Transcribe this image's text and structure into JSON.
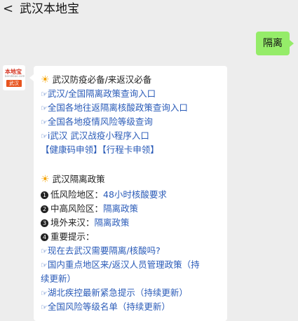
{
  "header": {
    "back_glyph": "<",
    "title": "武汉本地宝"
  },
  "sent_message": "隔离",
  "avatar": {
    "logo": "本地宝",
    "sub": "bendibao.com",
    "tag": "武汉"
  },
  "reply": {
    "section1": {
      "title": "武汉防疫必备/来返汉必备",
      "links": [
        "武汉/全国隔离政策查询入口",
        "全国各地往返隔离核酸政策查询入口",
        "全国各地疫情风险等级查询",
        "i武汉 武汉战疫小程序入口"
      ],
      "extra_links": [
        "【健康码申领】",
        "【行程卡申领】"
      ]
    },
    "section2": {
      "title": "武汉隔离政策",
      "items": [
        {
          "num": "1",
          "label": "低风险地区：",
          "value": "48小时核酸要求"
        },
        {
          "num": "2",
          "label": "中高风险区：",
          "value": "隔离政策"
        },
        {
          "num": "3",
          "label": "境外来汉：",
          "value": "隔离政策"
        },
        {
          "num": "4",
          "label": "重要提示：",
          "value": ""
        }
      ],
      "tips": [
        "现在去武汉需要隔离/核酸吗?",
        "国内重点地区来/返汉人员管理政策（持",
        "续更新）",
        "湖北疾控最新紧急提示（持续更新）",
        "全国风险等级名单（持续更新）"
      ]
    }
  }
}
